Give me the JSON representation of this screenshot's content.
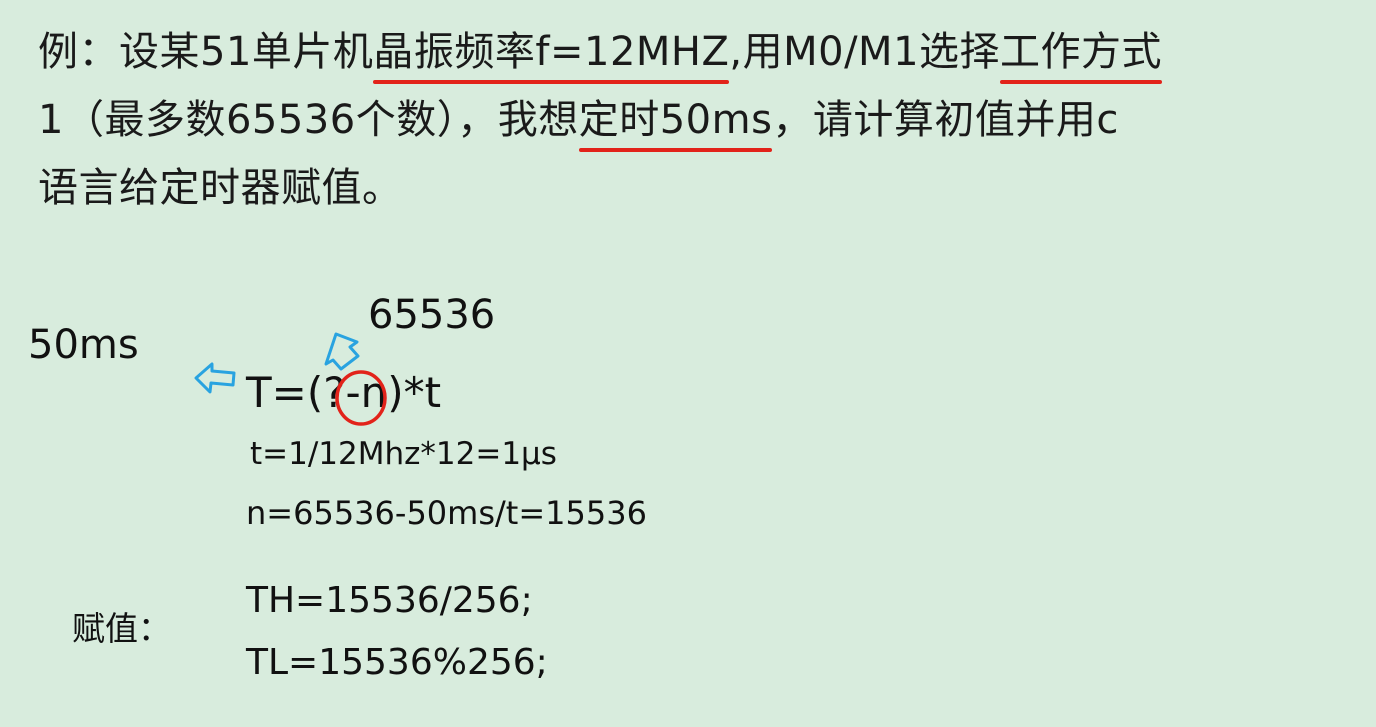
{
  "problem": {
    "line1": {
      "prefix": "例：设某51单片机",
      "underlined_1": "晶振频率f=12MHZ",
      "middle": ",用M0/M1选择",
      "underlined_2": "工作方式"
    },
    "line2": {
      "prefix": "1（最多数65536个数），我想",
      "underlined": "定时50ms",
      "suffix": "，请计算初值并用c"
    },
    "line3": "语言给定时器赋值。"
  },
  "notes": {
    "time_label": "50ms",
    "count_label": "65536",
    "formula_T": "T=(?-n)*t",
    "formula_t": "t=1/12Mhz*12=1μs",
    "formula_n": "n=65536-50ms/t=15536"
  },
  "assignment": {
    "label": "赋值：",
    "th": "TH=15536/256;",
    "tl": "TL=15536%256;"
  },
  "colors": {
    "background": "#d8ecdd",
    "underline": "#e2231a",
    "circle": "#e2231a",
    "arrow": "#29a3e0"
  }
}
